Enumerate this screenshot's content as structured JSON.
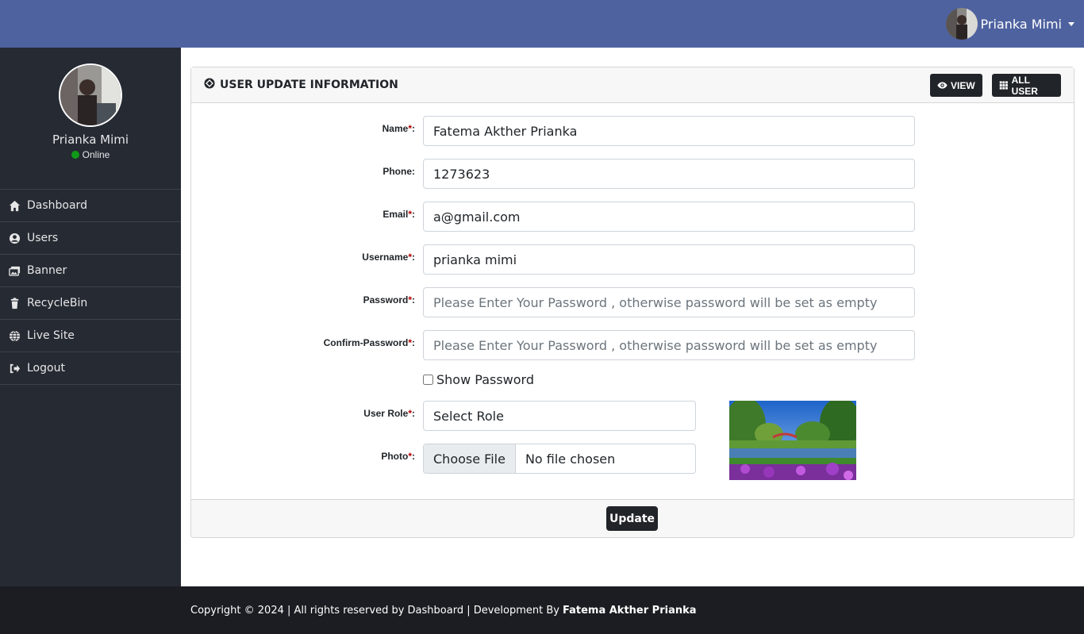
{
  "topbar": {
    "user_name": "Prianka Mimi"
  },
  "sidebar": {
    "profile_name": "Prianka Mimi",
    "status": "Online",
    "items": [
      {
        "label": "Dashboard",
        "icon": "home-icon"
      },
      {
        "label": "Users",
        "icon": "user-circle-icon"
      },
      {
        "label": "Banner",
        "icon": "images-icon"
      },
      {
        "label": "RecycleBin",
        "icon": "trash-icon"
      },
      {
        "label": "Live Site",
        "icon": "globe-icon"
      },
      {
        "label": "Logout",
        "icon": "sign-out-icon"
      }
    ]
  },
  "card": {
    "title": "USER UPDATE INFORMATION",
    "view_label": "VIEW",
    "all_user_label": "ALL USER"
  },
  "form": {
    "name_label": "Name",
    "name_value": "Fatema Akther Prianka",
    "phone_label": "Phone:",
    "phone_value": "1273623",
    "email_label": "Email",
    "email_value": "a@gmail.com",
    "username_label": "Username",
    "username_value": "prianka mimi",
    "password_label": "Password",
    "password_placeholder": "Please Enter Your Password , otherwise password will be set as empty",
    "confirm_label": "Confirm-Password",
    "confirm_placeholder": "Please Enter Your Password , otherwise password will be set as empty",
    "show_password": "Show Password",
    "role_label": "User Role",
    "role_value": "Select Role",
    "photo_label": "Photo",
    "file_button": "Choose File",
    "file_status": "No file chosen",
    "required_mark": "*",
    "colon": ":"
  },
  "update_label": "Update",
  "footer": {
    "text": "Copyright © 2024 | All rights reserved by Dashboard | Development By",
    "author": "Fatema Akther Prianka"
  },
  "colors": {
    "topbar": "#4e62a0",
    "sidebar": "#252a33",
    "footer": "#1b1d22",
    "button": "#212529",
    "online": "#109a19",
    "required": "#b00000"
  }
}
